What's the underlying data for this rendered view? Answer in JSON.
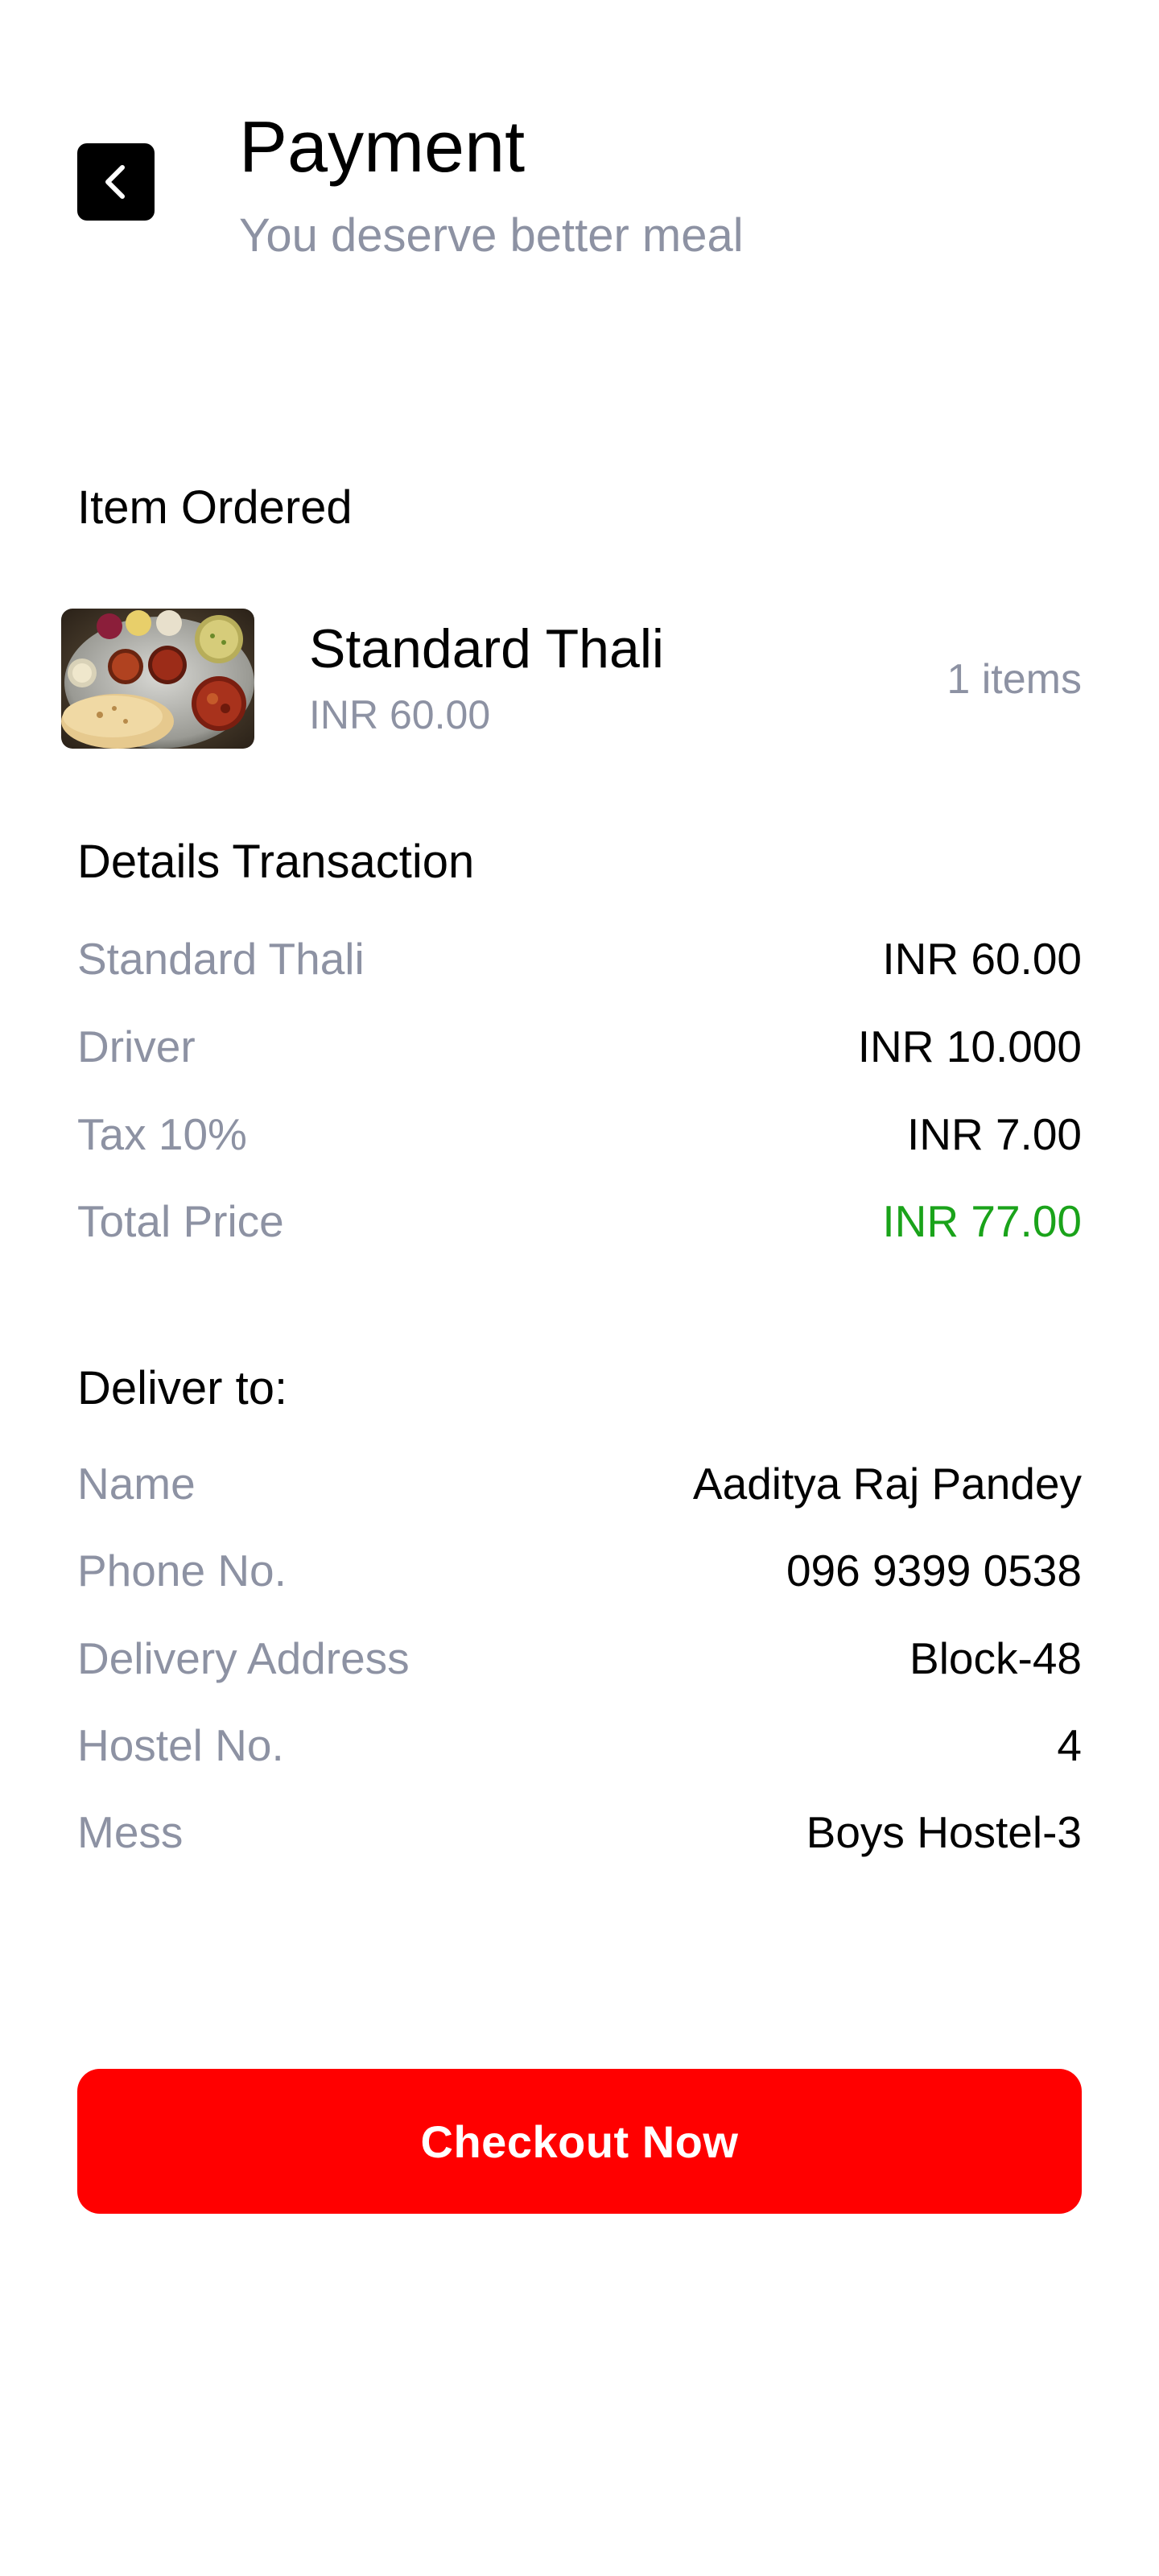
{
  "header": {
    "back_icon": "chevron-left-icon",
    "title": "Payment",
    "subtitle": "You deserve better meal"
  },
  "order": {
    "section_title": "Item Ordered",
    "item": {
      "name": "Standard Thali",
      "price": "INR 60.00",
      "quantity": "1 items",
      "thumbnail": "thali-food-photo"
    }
  },
  "transaction": {
    "section_title": "Details Transaction",
    "rows": [
      {
        "label": "Standard Thali",
        "value": "INR 60.00"
      },
      {
        "label": "Driver",
        "value": "INR 10.000"
      },
      {
        "label": "Tax 10%",
        "value": "INR 7.00"
      },
      {
        "label": "Total Price",
        "value": "INR 77.00"
      }
    ],
    "total_color": "#1aa31a"
  },
  "delivery": {
    "section_title": "Deliver to:",
    "rows": [
      {
        "label": "Name",
        "value": "Aaditya Raj Pandey"
      },
      {
        "label": "Phone No.",
        "value": "096 9399 0538"
      },
      {
        "label": "Delivery Address",
        "value": "Block-48"
      },
      {
        "label": "Hostel No.",
        "value": "4"
      },
      {
        "label": "Mess",
        "value": "Boys Hostel-3"
      }
    ]
  },
  "checkout": {
    "label": "Checkout Now",
    "color": "#ff0000"
  }
}
